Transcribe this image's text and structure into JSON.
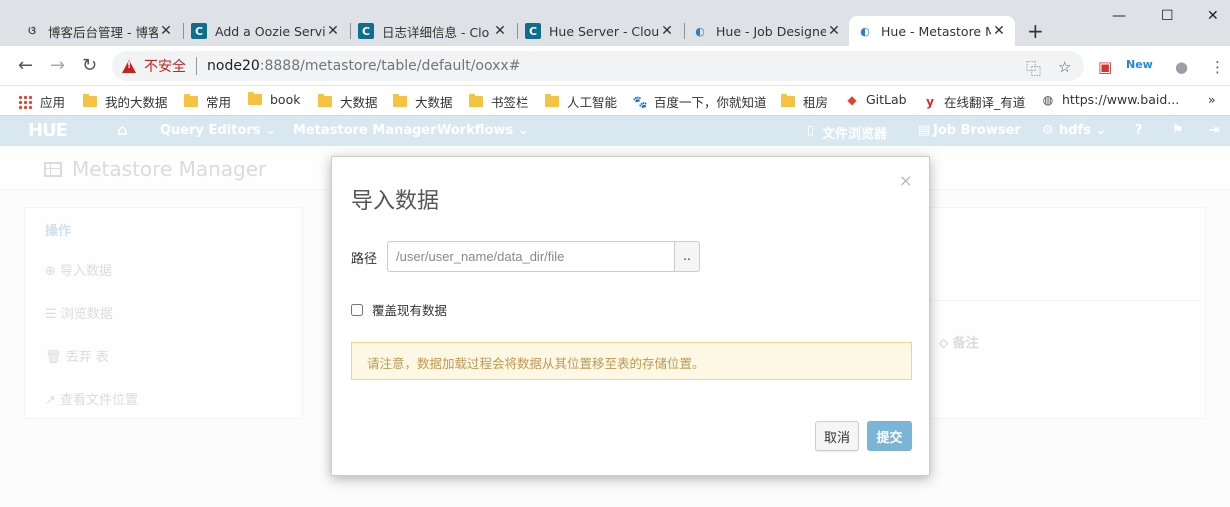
{
  "browser": {
    "tabs": [
      {
        "title": "博客后台管理 - 博客",
        "favicon": "blog-icon"
      },
      {
        "title": "Add a Oozie Servic",
        "favicon": "cloudera-icon"
      },
      {
        "title": "日志详细信息 - Clo",
        "favicon": "cloudera-icon"
      },
      {
        "title": "Hue Server - Clou",
        "favicon": "cloudera-icon"
      },
      {
        "title": "Hue - Job Designe",
        "favicon": "hue-icon"
      },
      {
        "title": "Hue - Metastore M",
        "favicon": "hue-icon"
      }
    ],
    "new_tab": "+",
    "window_controls": {
      "minimize": "—",
      "maximize": "☐",
      "close": "✕"
    },
    "address": {
      "security_label": "不安全",
      "host": "node20",
      "path": ":8888/metastore/table/default/ooxx#"
    },
    "bookmarks": [
      {
        "label": "应用",
        "icon": "apps-icon"
      },
      {
        "label": "我的大数据",
        "icon": "folder-icon"
      },
      {
        "label": "常用",
        "icon": "folder-icon"
      },
      {
        "label": "book",
        "icon": "folder-icon"
      },
      {
        "label": "大数据",
        "icon": "folder-icon"
      },
      {
        "label": "大数据",
        "icon": "folder-icon"
      },
      {
        "label": "书签栏",
        "icon": "folder-icon"
      },
      {
        "label": "人工智能",
        "icon": "folder-icon"
      },
      {
        "label": "百度一下，你就知道",
        "icon": "baidu-icon"
      },
      {
        "label": "租房",
        "icon": "folder-icon"
      },
      {
        "label": "GitLab",
        "icon": "gitlab-icon"
      },
      {
        "label": "在线翻译_有道",
        "icon": "youdao-icon"
      },
      {
        "label": "https://www.baid...",
        "icon": "globe-icon"
      }
    ],
    "bookmarks_more": "»"
  },
  "hue_nav": {
    "logo": "HUE",
    "items": {
      "query_editors": "Query Editors ⌄",
      "metastore": "Metastore Manager",
      "workflows": "Workflows ⌄",
      "file_browser": "文件浏览器",
      "job_browser": "Job Browser",
      "user": "hdfs ⌄"
    }
  },
  "page": {
    "title": "Metastore Manager",
    "sidebar": {
      "heading": "操作",
      "items": [
        "导入数据",
        "浏览数据",
        "丢弃 表",
        "查看文件位置"
      ]
    },
    "right_panel": {
      "comment_header": "备注"
    }
  },
  "modal": {
    "title": "导入数据",
    "close": "×",
    "path_label": "路径",
    "path_placeholder": "/user/user_name/data_dir/file",
    "browse_label": "..",
    "overwrite_label": "覆盖现有数据",
    "notice": "请注意，数据加载过程会将数据从其位置移至表的存储位置。",
    "cancel_label": "取消",
    "submit_label": "提交"
  },
  "colors": {
    "hue_nav_bg": "#c5dce9",
    "submit_bg": "#7ab5d8",
    "notice_bg": "#fcf8e3",
    "notice_text": "#c09853",
    "insecure_red": "#c5221f"
  }
}
